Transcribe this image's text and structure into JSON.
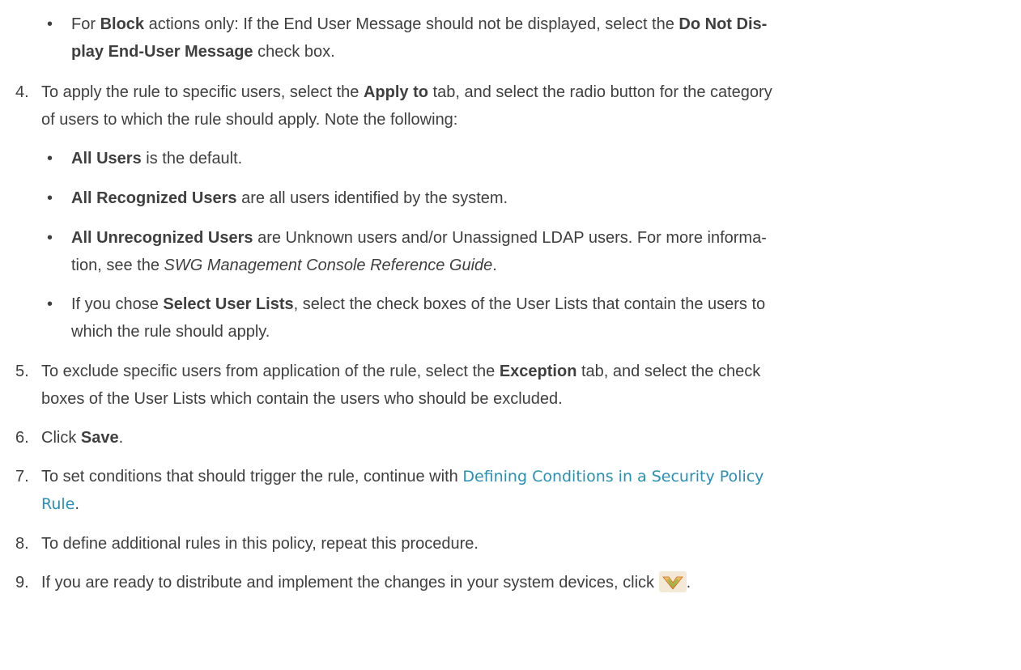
{
  "bullet_block_actions": {
    "bullet": "•",
    "pre": "For ",
    "b1": "Block",
    "mid1": " actions only: If the End User Message should not be displayed, select the ",
    "b2a": "Do Not Dis-",
    "b2b": "play End-User Message",
    "post": " check box."
  },
  "step4": {
    "num": "4.",
    "pre": "To apply the rule to specific users, select the ",
    "b1": "Apply to",
    "mid1": " tab, and select the radio button for the category",
    "line2": "of users to which the rule should apply. Note the following:",
    "bullets": [
      {
        "bullet": "•",
        "bold": "All Users",
        "text": " is the default."
      },
      {
        "bullet": "•",
        "bold": "All Recognized Users",
        "text": " are all users identified by the system."
      },
      {
        "bullet": "•",
        "bold": "All Unrecognized Users",
        "text": " are Unknown users and/or Unassigned LDAP users. For more informa-",
        "line2_pre": "tion, see the ",
        "line2_italic": "SWG Management Console Reference Guide",
        "line2_post": "."
      },
      {
        "bullet": "•",
        "pre": "If you chose ",
        "bold": "Select User Lists",
        "text": ", select the check boxes of the User Lists that contain the users to",
        "line2": "which the rule should apply."
      }
    ]
  },
  "step5": {
    "num": "5.",
    "pre": "To exclude specific users from application of the rule, select the ",
    "b1": "Exception",
    "mid1": " tab, and select the check",
    "line2": "boxes of the User Lists which contain the users who should be excluded."
  },
  "step6": {
    "num": "6.",
    "pre": "Click ",
    "b1": "Save",
    "post": "."
  },
  "step7": {
    "num": "7.",
    "pre": "To set conditions that should trigger the rule, continue with ",
    "link_line1": "Defining Conditions in a Security Policy",
    "link_line2": "Rule",
    "post": "."
  },
  "step8": {
    "num": "8.",
    "text": "To define additional rules in this policy, repeat this procedure."
  },
  "step9": {
    "num": "9.",
    "text": "If you are ready to distribute and implement the changes in your system devices, click ",
    "icon": "deploy-changes-icon",
    "post": "."
  },
  "colors": {
    "text": "#3f3f3f",
    "link": "#2a8fb5",
    "icon_orange": "#e8a13a",
    "icon_green": "#8bbd4a"
  }
}
